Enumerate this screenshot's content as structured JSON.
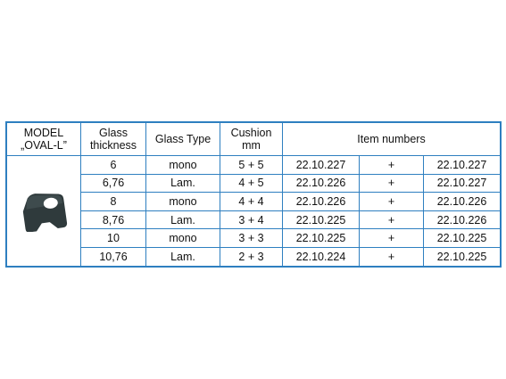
{
  "header": {
    "model_line1": "MODEL",
    "model_line2": "„OVAL-L”",
    "glass_line1": "Glass",
    "glass_line2": "thickness",
    "glass_type": "Glass Type",
    "cushion_line1": "Cushion",
    "cushion_line2": "mm",
    "item_numbers": "Item numbers"
  },
  "image": {
    "icon": "oval-l-cushion-pad-icon",
    "color": "#2f3a3c"
  },
  "rows": [
    {
      "thickness": "6",
      "type": "mono",
      "cushion": "5 + 5",
      "item_a": "22.10.227",
      "plus": "+",
      "item_b": "22.10.227"
    },
    {
      "thickness": "6,76",
      "type": "Lam.",
      "cushion": "4 + 5",
      "item_a": "22.10.226",
      "plus": "+",
      "item_b": "22.10.227"
    },
    {
      "thickness": "8",
      "type": "mono",
      "cushion": "4 + 4",
      "item_a": "22.10.226",
      "plus": "+",
      "item_b": "22.10.226"
    },
    {
      "thickness": "8,76",
      "type": "Lam.",
      "cushion": "3 + 4",
      "item_a": "22.10.225",
      "plus": "+",
      "item_b": "22.10.226"
    },
    {
      "thickness": "10",
      "type": "mono",
      "cushion": "3 + 3",
      "item_a": "22.10.225",
      "plus": "+",
      "item_b": "22.10.225"
    },
    {
      "thickness": "10,76",
      "type": "Lam.",
      "cushion": "2 + 3",
      "item_a": "22.10.224",
      "plus": "+",
      "item_b": "22.10.225"
    }
  ],
  "colors": {
    "border": "#2e7fc0"
  }
}
